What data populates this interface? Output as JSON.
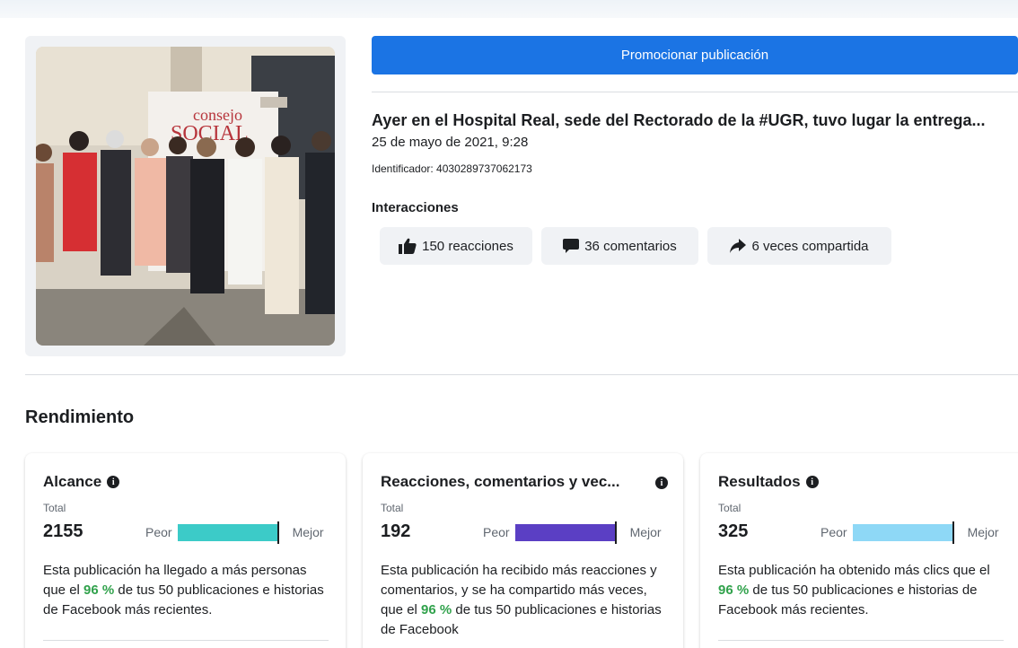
{
  "promote_button": "Promocionar publicación",
  "post": {
    "title": "Ayer en el Hospital Real, sede del Rectorado de la #UGR, tuvo lugar la entrega...",
    "date": "25 de mayo de 2021, 9:28",
    "id": "Identificador: 4030289737062173",
    "photo_banner": "consejo SOCIAL"
  },
  "interactions": {
    "label": "Interacciones",
    "reactions": "150 reacciones",
    "comments": "36 comentarios",
    "shares": "6 veces compartida"
  },
  "performance": {
    "title": "Rendimiento",
    "cards": [
      {
        "title": "Alcance",
        "total_label": "Total",
        "value": "2155",
        "worse": "Peor",
        "better": "Mejor",
        "bar_color": "#3ccbc8",
        "percentile": 96,
        "desc_before": "Esta publicación ha llegado a más personas que el ",
        "pct": "96 %",
        "desc_after": " de tus 50 publicaciones e historias de Facebook más recientes."
      },
      {
        "title": "Reacciones, comentarios y vec...",
        "total_label": "Total",
        "value": "192",
        "worse": "Peor",
        "better": "Mejor",
        "bar_color": "#5b3fc4",
        "percentile": 96,
        "desc_before": "Esta publicación ha recibido más reacciones y comentarios, y se ha compartido más veces, que el ",
        "pct": "96 %",
        "desc_after": " de tus 50 publicaciones e historias de Facebook"
      },
      {
        "title": "Resultados",
        "total_label": "Total",
        "value": "325",
        "worse": "Peor",
        "better": "Mejor",
        "bar_color": "#8ed8f6",
        "percentile": 96,
        "desc_before": "Esta publicación ha obtenido más clics que el ",
        "pct": "96 %",
        "desc_after": " de tus 50 publicaciones e historias de Facebook más recientes."
      }
    ]
  }
}
